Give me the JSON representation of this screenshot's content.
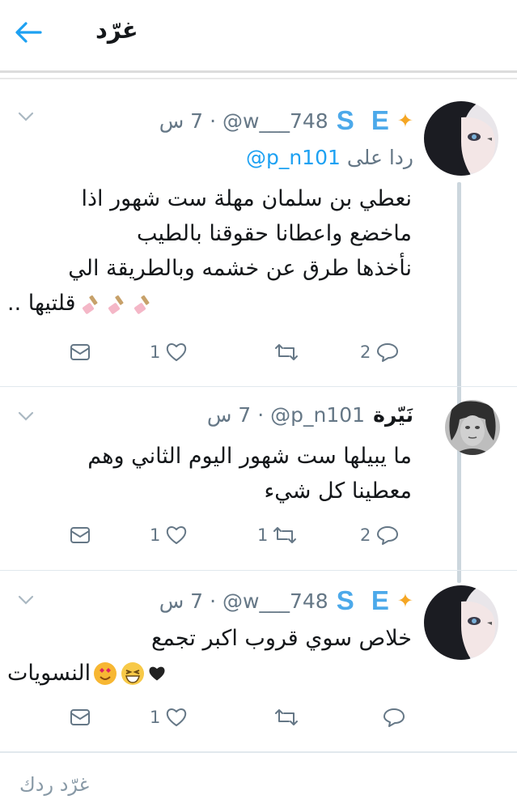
{
  "header": {
    "title": "غرّد"
  },
  "tweets": [
    {
      "name_badge": "S E",
      "name_icon": "sparkle",
      "handle": "@w___748",
      "dot": "·",
      "time": "7 س",
      "reply_prefix": "ردا على",
      "reply_mention": "@p_n101",
      "lines": [
        "نعطي بن سلمان مهلة ست شهور اذا",
        "ماخضع واعطانا حقوقنا بالطيب",
        "نأخذها طرق عن خشمه وبالطريقة الي",
        "قلتيها .."
      ],
      "emojis": [
        "nail-polish",
        "nail-polish",
        "nail-polish"
      ],
      "replies": "2",
      "retweets": "",
      "likes": "1"
    },
    {
      "name": "نَيّرة",
      "handle": "@p_n101",
      "dot": "·",
      "time": "7 س",
      "lines": [
        "ما يبيلها ست شهور اليوم الثاني وهم",
        "معطينا كل شيء"
      ],
      "replies": "2",
      "retweets": "1",
      "likes": "1"
    },
    {
      "name_badge": "S E",
      "name_icon": "sparkle",
      "handle": "@w___748",
      "dot": "·",
      "time": "7 س",
      "lines": [
        "خلاص سوي قروب اكبر تجمع",
        "النسويات"
      ],
      "emojis": [
        "heart-eyes-face",
        "grinning-squinting-face",
        "black-heart"
      ],
      "replies": "",
      "retweets": "",
      "likes": "1"
    }
  ],
  "compose": {
    "placeholder": "غرّد ردك"
  },
  "colors": {
    "accent": "#1da1f2",
    "secondary": "#657786",
    "divider": "#e1e8ed",
    "badge": "#4ca9ea",
    "sparkle": "#f5a623"
  }
}
